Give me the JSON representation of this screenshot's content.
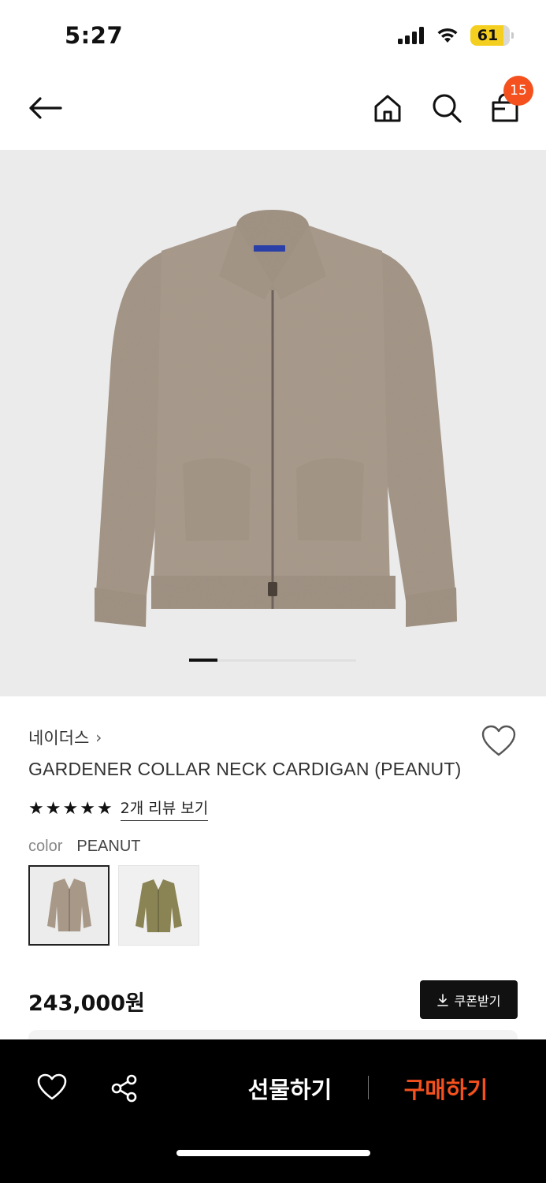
{
  "status_bar": {
    "time": "5:27",
    "battery": "61"
  },
  "nav": {
    "cart_count": "15"
  },
  "product": {
    "brand": "네이더스",
    "brand_chevron": "›",
    "title": "GARDENER COLLAR NECK CARDIGAN (PEANUT)",
    "rating_stars": 5,
    "review_link": "2개 리뷰 보기",
    "color_label": "color",
    "color_value": "PEANUT",
    "swatches": [
      {
        "name": "PEANUT",
        "color": "#a89888"
      },
      {
        "name": "OLIVE",
        "color": "#8a8354"
      }
    ],
    "price": "243,000원",
    "coupon_label": "쿠폰받기",
    "garment_color": "#a49687"
  },
  "carousel": {
    "current": 1
  },
  "bottom_bar": {
    "gift_label": "선물하기",
    "buy_label": "구매하기",
    "accent": "#f4511e"
  }
}
